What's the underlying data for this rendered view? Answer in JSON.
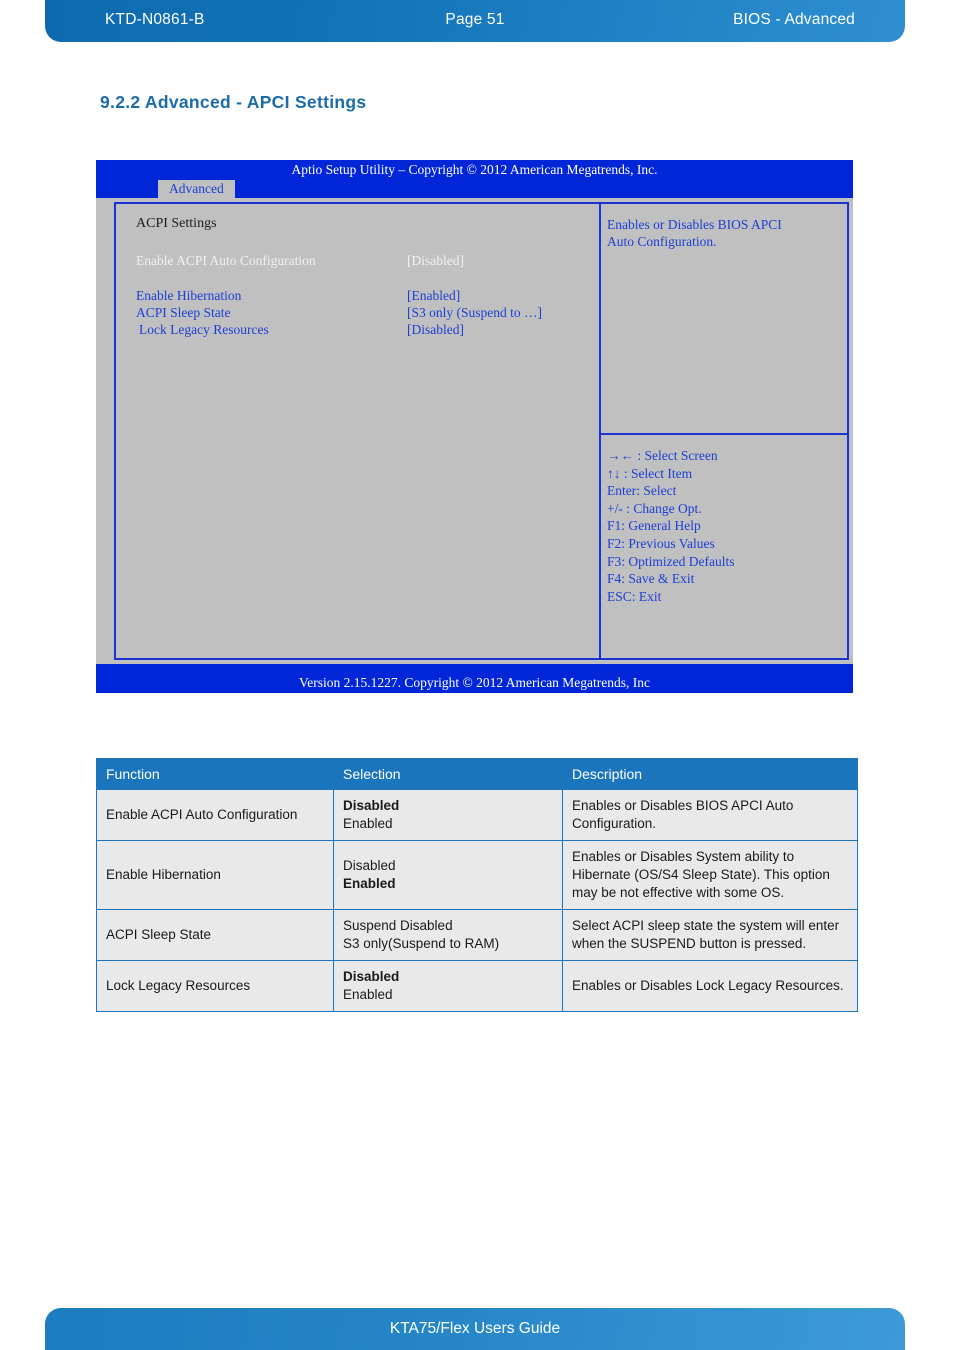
{
  "header": {
    "doc_id": "KTD-N0861-B",
    "page": "Page 51",
    "section": "BIOS  - Advanced"
  },
  "section_title": "9.2.2  Advanced  -  APCI Settings",
  "bios": {
    "title": "Aptio Setup Utility  –  Copyright © 2012 American Megatrends, Inc.",
    "tab": "Advanced",
    "group_heading": "ACPI Settings",
    "rows": [
      {
        "label": "Enable ACPI Auto Configuration",
        "value": "[Disabled]"
      },
      {
        "label": "Enable Hibernation",
        "value": "[Enabled]"
      },
      {
        "label": "ACPI Sleep State",
        "value": "[S3 only (Suspend to …]"
      },
      {
        "label": "Lock Legacy Resources",
        "value": "[Disabled]"
      }
    ],
    "help_line1": "Enables or Disables BIOS APCI",
    "help_line2": "Auto Configuration.",
    "keys": [
      "→←  : Select Screen",
      "↑↓  : Select Item",
      "Enter: Select",
      "+/-  : Change Opt.",
      "F1: General Help",
      "F2: Previous Values",
      "F3: Optimized Defaults",
      "F4: Save & Exit",
      "ESC: Exit"
    ],
    "version": "Version 2.15.1227. Copyright © 2012 American Megatrends, Inc"
  },
  "table": {
    "headers": [
      "Function",
      "Selection",
      "Description"
    ],
    "rows": [
      {
        "function": "Enable ACPI Auto Configuration",
        "selection_bold": "Disabled",
        "selection_plain": "Enabled",
        "bold_first": true,
        "description": "Enables or Disables BIOS APCI Auto Configuration."
      },
      {
        "function": "Enable Hibernation",
        "selection_plain": "Disabled",
        "selection_bold": "Enabled",
        "bold_first": false,
        "description": "Enables or Disables System ability to Hibernate (OS/S4 Sleep State). This option may be not effective with some OS."
      },
      {
        "function": "ACPI Sleep State",
        "selection_plain": "Suspend Disabled",
        "selection_plain2": "S3 only(Suspend to RAM)",
        "bold_first": null,
        "description": "Select ACPI sleep state the system will enter when the SUSPEND button is pressed."
      },
      {
        "function": "Lock Legacy Resources",
        "selection_bold": "Disabled",
        "selection_plain": "Enabled",
        "bold_first": true,
        "description": "Enables or Disables Lock Legacy Resources."
      }
    ]
  },
  "footer": {
    "title": "KTA75/Flex Users Guide"
  },
  "colors": {
    "brand_blue": "#1b75bc",
    "bios_blue": "#0026d8",
    "bios_gray": "#c0c0c0",
    "bios_text_blue": "#1c3fd4",
    "table_cell_bg": "#e9e9e9"
  }
}
